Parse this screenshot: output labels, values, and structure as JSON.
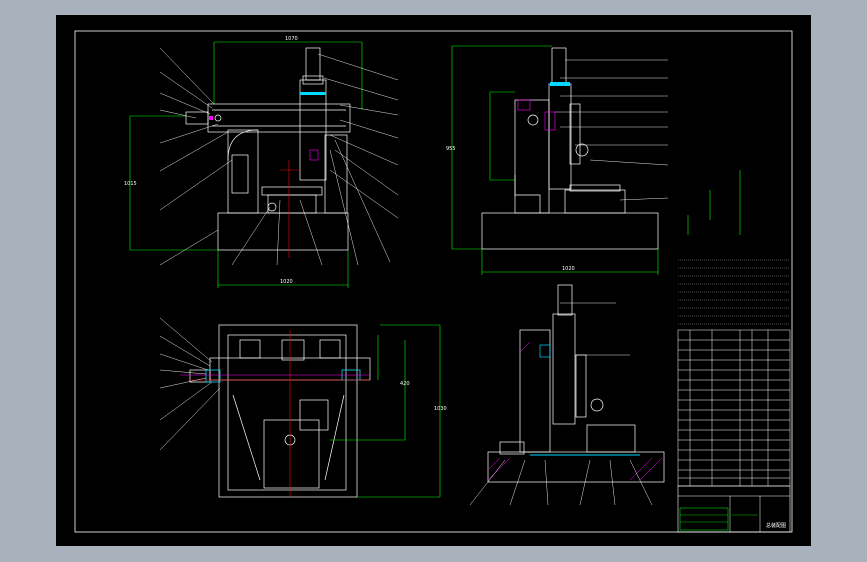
{
  "drawing": {
    "top_left_dim": "1070",
    "top_left_height": "1015",
    "top_left_base": "1020",
    "top_right_height": "955",
    "top_right_base": "1020",
    "bottom_left_height": "1030",
    "bottom_left_height2": "420",
    "title_block_name": "总装配图"
  },
  "colors": {
    "background": "#000000",
    "outer_frame": "#a9b1bd",
    "line_white": "#ffffff",
    "dim_green": "#00ff00",
    "center_red": "#ff0000",
    "accent_cyan": "#00d8ff",
    "accent_magenta": "#ff00ff"
  }
}
